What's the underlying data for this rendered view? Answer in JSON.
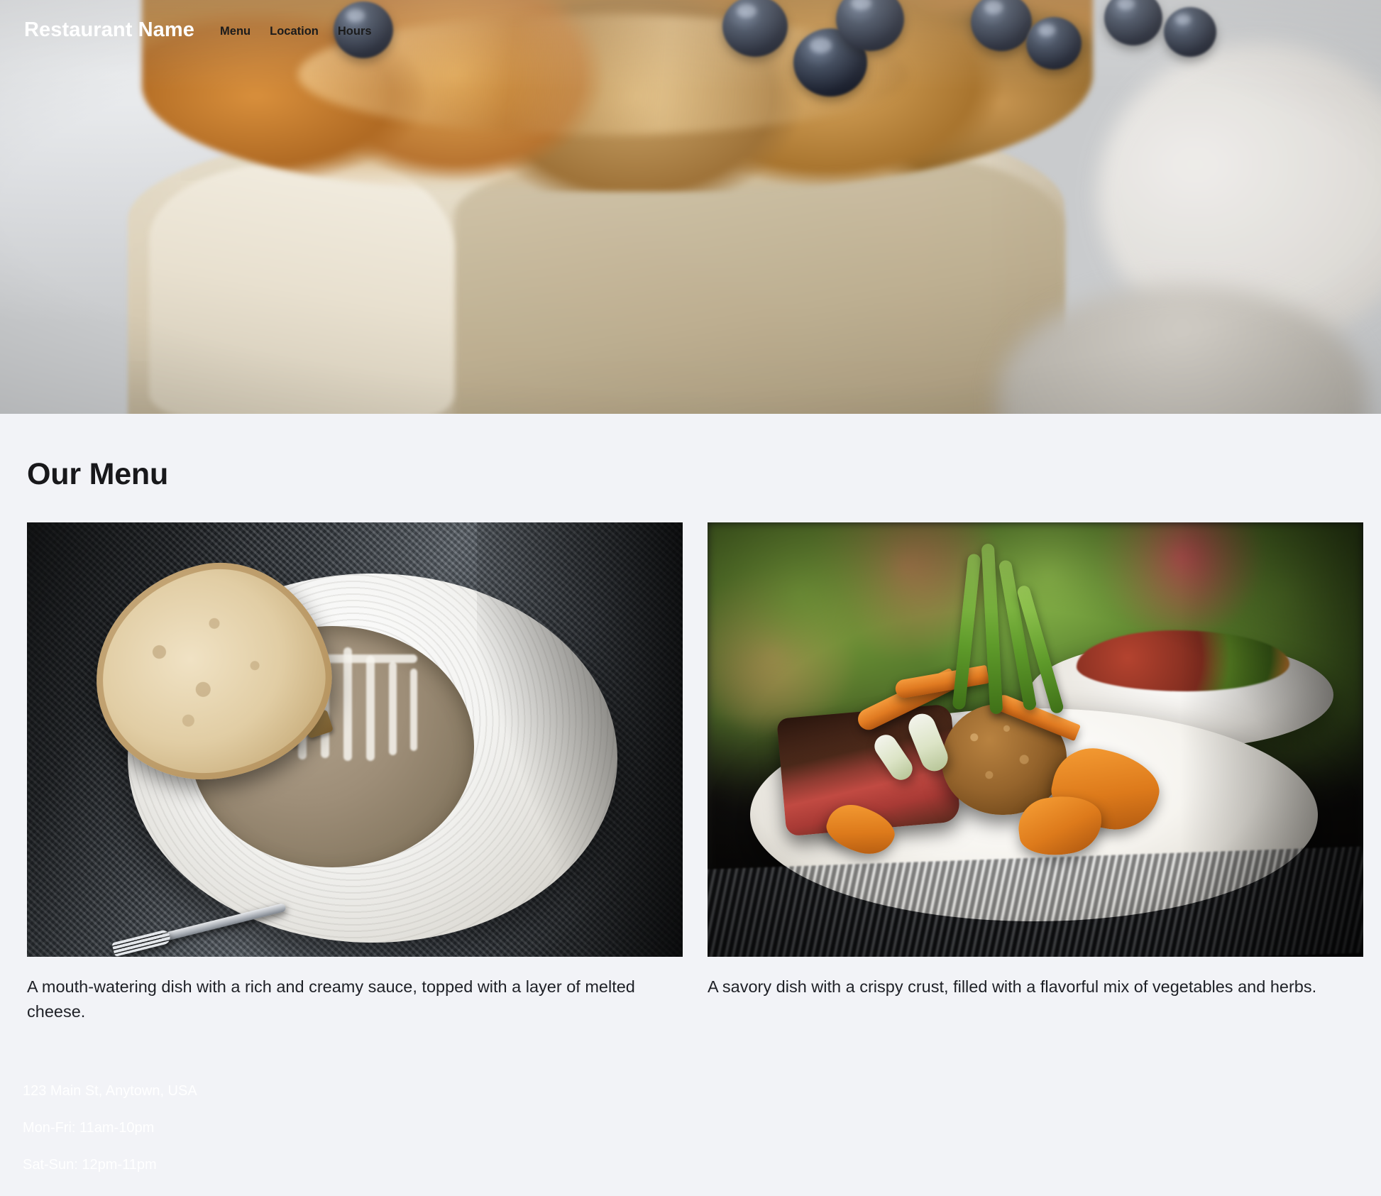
{
  "site": {
    "brand": "Restaurant Name",
    "background_color": "#f2f3f7",
    "text_color": "#1a202c"
  },
  "nav": {
    "items": [
      {
        "label": "Menu"
      },
      {
        "label": "Location"
      },
      {
        "label": "Hours"
      }
    ]
  },
  "hero": {
    "image_alt": "Close-up of a frosted layer cake topped with caramelized pastry and blueberries"
  },
  "menu": {
    "title": "Our Menu",
    "items": [
      {
        "image_alt": "Bowl of creamy mushroom soup with croutons and a slice of bread on a white plate",
        "description": "A mouth-watering dish with a rich and creamy sauce, topped with a layer of melted cheese."
      },
      {
        "image_alt": "Plated steak with croquette, carrots and scallions in a garden setting",
        "description": "A savory dish with a crispy crust, filled with a flavorful mix of vegetables and herbs."
      }
    ]
  },
  "footer": {
    "address": "123 Main St, Anytown, USA",
    "hours_weekday": "Mon-Fri: 11am-10pm",
    "hours_weekend": "Sat-Sun: 12pm-11pm"
  }
}
